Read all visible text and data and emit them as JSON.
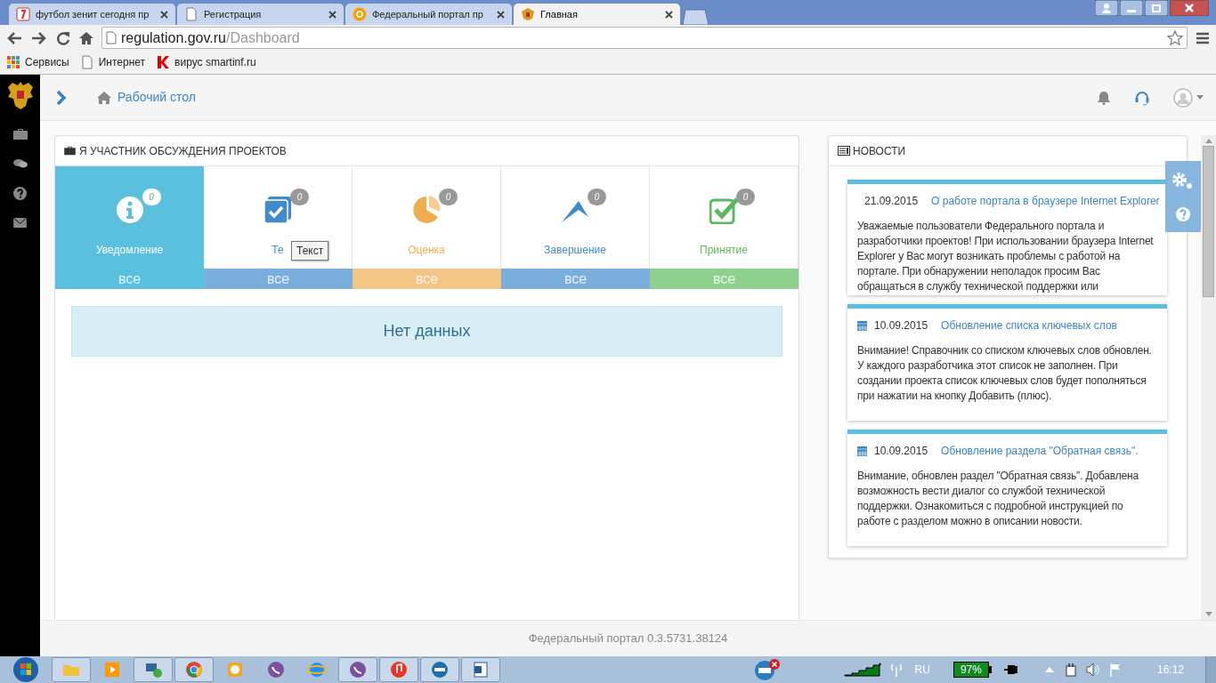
{
  "browser": {
    "tabs": [
      {
        "title": "футбол зенит сегодня пр",
        "kind": "yandex",
        "selected": false
      },
      {
        "title": "Регистрация",
        "kind": "page",
        "selected": false
      },
      {
        "title": "Федеральный портал пр",
        "kind": "mail",
        "selected": false
      },
      {
        "title": "Главная",
        "kind": "emblem",
        "selected": true
      }
    ],
    "address": {
      "host": "regulation.gov.ru",
      "path": "/Dashboard"
    },
    "bookmarks": [
      {
        "label": "Сервисы",
        "kind": "apps"
      },
      {
        "label": "Интернет",
        "kind": "page"
      },
      {
        "label": "вирус smartinf.ru",
        "kind": "kaspersky"
      }
    ]
  },
  "header": {
    "breadcrumb": "Рабочий стол"
  },
  "projects_panel": {
    "title": "Я УЧАСТНИК ОБСУЖДЕНИЯ ПРОЕКТОВ",
    "stages": [
      {
        "label": "Уведомление",
        "badge": "0",
        "link": "все",
        "kind": "info",
        "color": "#5bc0de",
        "selected": true
      },
      {
        "label": "Те",
        "badge": "0",
        "link": "все",
        "kind": "check-square",
        "color": "#428bca",
        "selected": false
      },
      {
        "label": "Оценка",
        "badge": "0",
        "link": "все",
        "kind": "pie",
        "color": "#f0ad4e",
        "selected": false
      },
      {
        "label": "Завершение",
        "badge": "0",
        "link": "все",
        "kind": "peak",
        "color": "#428bca",
        "selected": false
      },
      {
        "label": "Принятие",
        "badge": "0",
        "link": "все",
        "kind": "check",
        "color": "#5cb85c",
        "selected": false
      }
    ],
    "tooltip": "Текст",
    "empty": "Нет данных"
  },
  "news_panel": {
    "title": "НОВОСТИ",
    "items": [
      {
        "date": "21.09.2015",
        "title": "О работе портала в браузере Internet Explorer",
        "body": "Уважаемые пользователи Федерального портала и разработчики проектов! При использовании браузера Internet Explorer у Вас могут возникать проблемы с работой на портале. При обнаружении неполадок просим Вас обращаться в службу технической поддержки или",
        "clipped": true
      },
      {
        "date": "10.09.2015",
        "title": "Обновление списка ключевых слов",
        "body": "Внимание! Справочник со списком ключевых слов обновлен. У каждого разработчика этот список не заполнен. При создании проекта список ключевых слов будет пополняться при нажатии на кнопку Добавить (плюс).",
        "clipped": false
      },
      {
        "date": "10.09.2015",
        "title": "Обновление раздела \"Обратная связь\".",
        "body": "Внимание, обновлен раздел \"Обратная связь\". Добавлена возможность вести диалог со службой технической поддержки. Ознакомиться с подробной инструкцией по работе с разделом можно в описании новости.",
        "clipped": false
      }
    ]
  },
  "footer": "Федеральный портал 0.3.5731.38124",
  "taskbar": {
    "language": "RU",
    "battery": "97%",
    "clock": "16:12"
  }
}
